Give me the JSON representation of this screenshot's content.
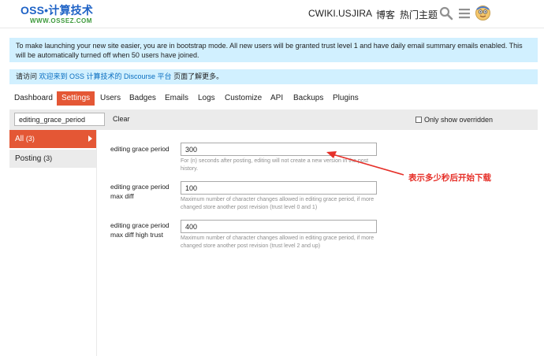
{
  "colors": {
    "accent": "#e45735",
    "notice_bg": "#d1f0ff",
    "link": "#0a6ec0",
    "annotation": "#e63029"
  },
  "header": {
    "logo_main": "OSS•计算技术",
    "logo_sub": "WWW.OSSEZ.COM",
    "nav": [
      "CWIKI.US",
      "JIRA",
      "博客",
      "热门主题"
    ],
    "icons": [
      "search-icon",
      "hamburger-menu-icon",
      "user-avatar-icon"
    ]
  },
  "notices": {
    "bootstrap": "To make launching your new site easier, you are in bootstrap mode. All new users will be granted trust level 1 and have daily email summary emails enabled. This will be automatically turned off when 50 users have joined.",
    "welcome_prefix": "请访问",
    "welcome_link": "欢迎来到 OSS 计算技术的 Discourse 平台",
    "welcome_suffix": "页面了解更多。"
  },
  "tabs": [
    "Dashboard",
    "Settings",
    "Users",
    "Badges",
    "Emails",
    "Logs",
    "Customize",
    "API",
    "Backups",
    "Plugins"
  ],
  "filter": {
    "value": "editing_grace_period",
    "clear_label": "Clear",
    "only_overridden_label": "Only show overridden"
  },
  "sidebar": [
    {
      "label": "All",
      "count": "(3)"
    },
    {
      "label": "Posting",
      "count": "(3)"
    }
  ],
  "settings": [
    {
      "label": "editing grace period",
      "value": "300",
      "desc": "For (n) seconds after posting, editing will not create a new version in the post history."
    },
    {
      "label": "editing grace period max diff",
      "value": "100",
      "desc": "Maximum number of character changes allowed in editing grace period, if more changed store another post revision (trust level 0 and 1)"
    },
    {
      "label": "editing grace period max diff high trust",
      "value": "400",
      "desc": "Maximum number of character changes allowed in editing grace period, if more changed store another post revision (trust level 2 and up)"
    }
  ],
  "annotation": "表示多少秒后开始下载"
}
